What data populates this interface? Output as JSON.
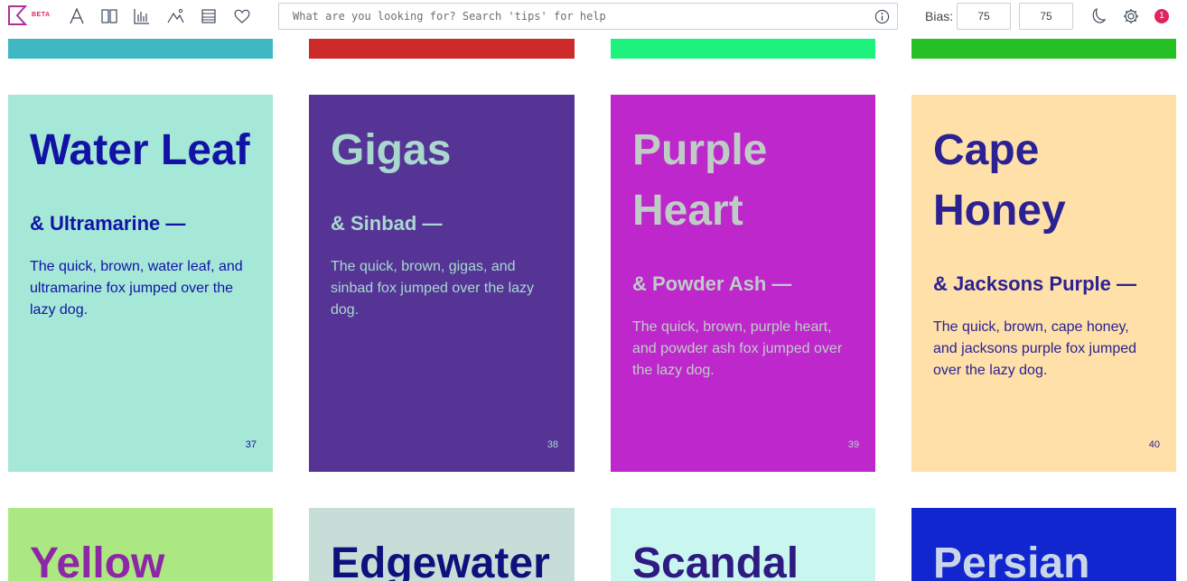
{
  "topbar": {
    "beta_label": "BETA",
    "search_placeholder": "What are you looking for? Search 'tips' for help",
    "bias_label": "Bias:",
    "bias_values": [
      "75",
      "75"
    ],
    "notification_count": "1",
    "icons": [
      "logo-icon",
      "font-icon",
      "columns-icon",
      "chart-icon",
      "image-icon",
      "list-icon",
      "heart-icon",
      "info-icon",
      "moon-icon",
      "gear-icon"
    ],
    "accent_color": "#e0245e"
  },
  "strips": [
    {
      "color": "#3fb8c4"
    },
    {
      "color": "#cf2a2a"
    },
    {
      "color": "#1ef27e"
    },
    {
      "color": "#24c024"
    }
  ],
  "cards": [
    {
      "title": "Water Leaf",
      "sub": "& Ultramarine —",
      "body": "The quick, brown, water leaf, and ultramarine fox jumped over the lazy dog.",
      "num": "37",
      "bg": "#a5e8d8",
      "fg": "#1212a5"
    },
    {
      "title": "Gigas",
      "sub": "& Sinbad —",
      "body": "The quick, brown, gigas, and sinbad fox jumped over the lazy dog.",
      "num": "38",
      "bg": "#553496",
      "fg": "#a9d8cf"
    },
    {
      "title": "Purple Heart",
      "sub": "& Powder Ash —",
      "body": "The quick, brown, purple heart, and powder ash fox jumped over the lazy dog.",
      "num": "39",
      "bg": "#be27cc",
      "fg": "#bfccc6"
    },
    {
      "title": "Cape Honey",
      "sub": "& Jacksons Purple —",
      "body": "The quick, brown, cape honey, and jacksons purple fox jumped over the lazy dog.",
      "num": "40",
      "bg": "#fee0a8",
      "fg": "#2b2193"
    },
    {
      "title": "Yellow",
      "bg": "#ace881",
      "fg": "#8e26a8"
    },
    {
      "title": "Edgewater",
      "bg": "#c6ded7",
      "fg": "#10107d"
    },
    {
      "title": "Scandal",
      "bg": "#c9f7f0",
      "fg": "#2e1a82"
    },
    {
      "title": "Persian",
      "bg": "#1126ce",
      "fg": "#c9d6ea"
    }
  ]
}
